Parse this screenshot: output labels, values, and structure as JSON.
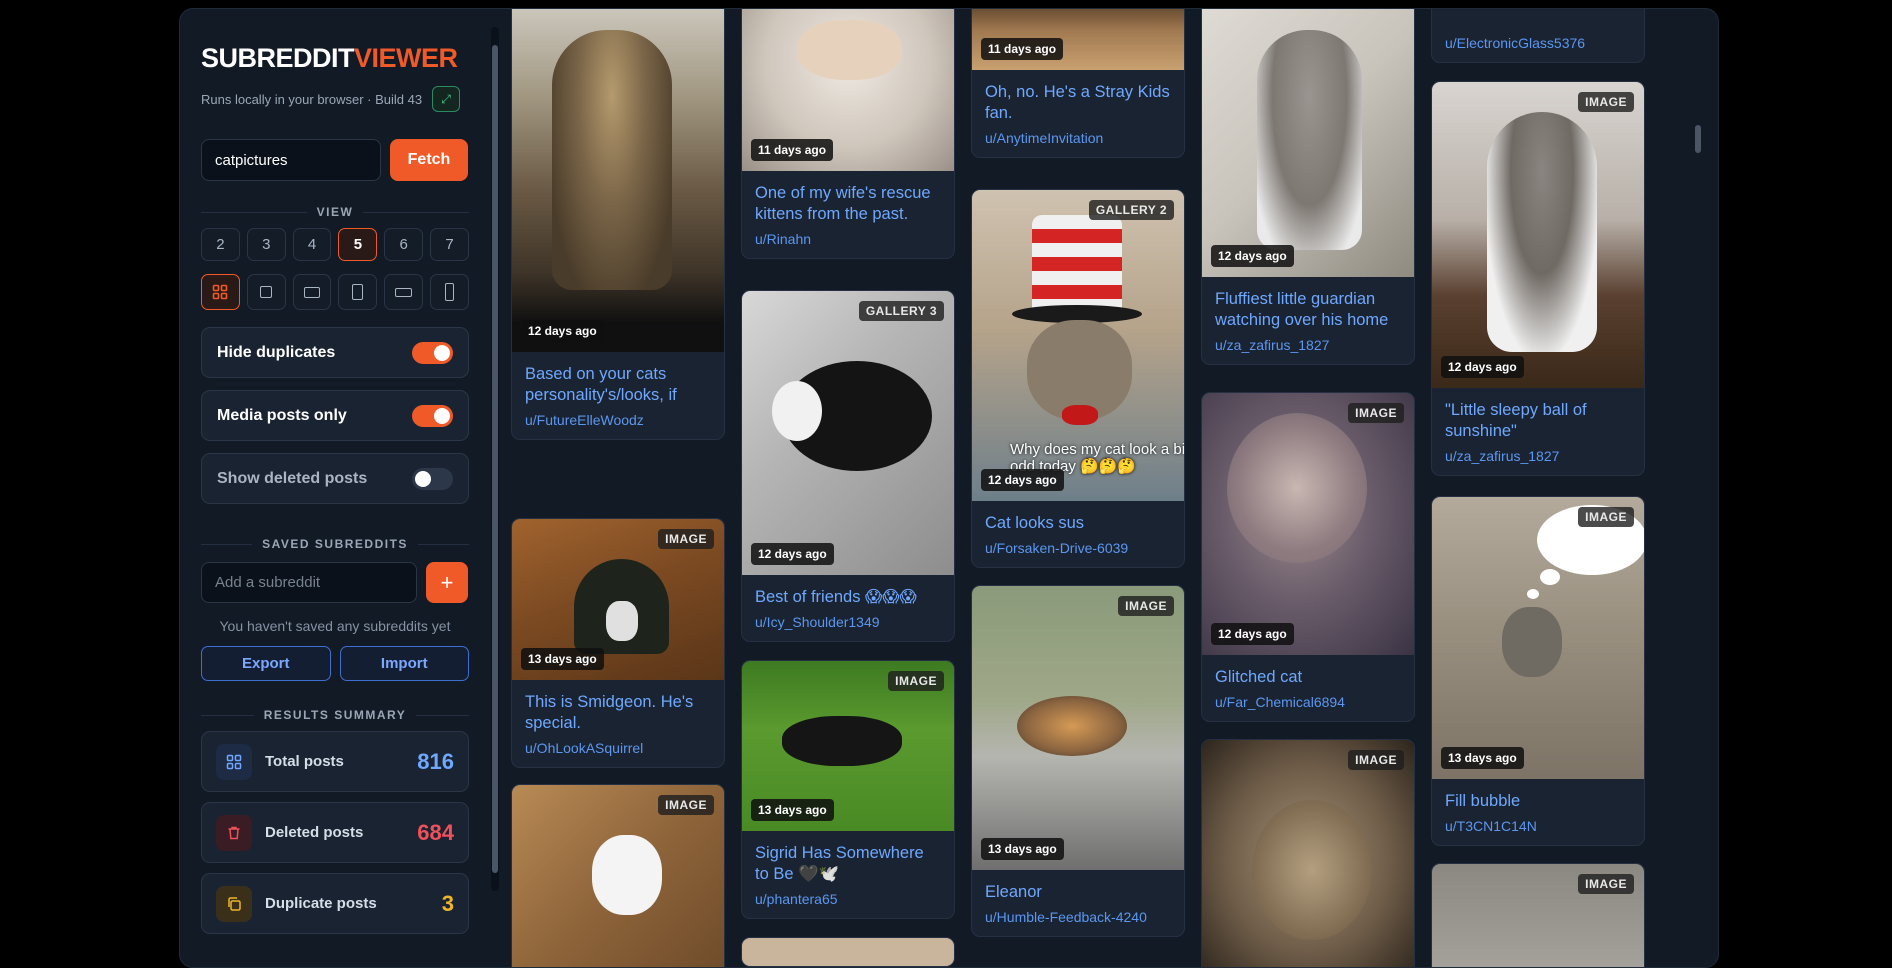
{
  "brand": {
    "part1": "SUBREDDIT",
    "part2": "VIEWER",
    "subtitle": "Runs locally in your browser · Build 43"
  },
  "search": {
    "value": "catpictures",
    "fetch_label": "Fetch"
  },
  "view": {
    "label": "VIEW",
    "columns": [
      "2",
      "3",
      "4",
      "5",
      "6",
      "7"
    ],
    "active_columns": "5"
  },
  "toggles": {
    "hide_duplicates": "Hide duplicates",
    "media_only": "Media posts only",
    "show_deleted": "Show deleted posts"
  },
  "saved": {
    "label": "SAVED SUBREDDITS",
    "placeholder": "Add a subreddit",
    "add_label": "+",
    "empty": "You haven't saved any subreddits yet",
    "export": "Export",
    "import": "Import"
  },
  "summary": {
    "label": "RESULTS SUMMARY",
    "total_label": "Total posts",
    "total": "816",
    "deleted_label": "Deleted posts",
    "deleted": "684",
    "duplicate_label": "Duplicate posts",
    "duplicate": "3"
  },
  "colors": {
    "accent": "#f05a28",
    "link": "#6ea8ff",
    "total": "#6ea8ff",
    "deleted": "#f0505a",
    "duplicate": "#f0b429"
  },
  "posts": [
    {
      "badge": "",
      "age": "12 days ago",
      "title": "Based on your cats personality's/looks, if",
      "author": "u/FutureElleWoodz"
    },
    {
      "badge": "IMAGE",
      "age": "13 days ago",
      "title": "This is Smidgeon. He's special.",
      "author": "u/OhLookASquirrel"
    },
    {
      "badge": "IMAGE",
      "age": "",
      "title": "",
      "author": ""
    },
    {
      "badge": "",
      "age": "11 days ago",
      "title": "One of my wife's rescue kittens from the past.",
      "author": "u/Rinahn"
    },
    {
      "badge": "GALLERY 3",
      "age": "12 days ago",
      "title": "Best of friends 😱😱😱",
      "author": "u/Icy_Shoulder1349"
    },
    {
      "badge": "IMAGE",
      "age": "13 days ago",
      "title": "Sigrid Has Somewhere to Be 🖤🕊️",
      "author": "u/phantera65"
    },
    {
      "badge": "",
      "age": "11 days ago",
      "title": "Oh, no. He's a Stray Kids fan.",
      "author": "u/AnytimeInvitation"
    },
    {
      "badge": "GALLERY 2",
      "age": "12 days ago",
      "title": "Cat looks sus",
      "author": "u/Forsaken-Drive-6039",
      "caption": "Why does my cat look a bit odd today 🤔🤔🤔"
    },
    {
      "badge": "IMAGE",
      "age": "13 days ago",
      "title": "Eleanor",
      "author": "u/Humble-Feedback-4240"
    },
    {
      "badge": "",
      "age": "12 days ago",
      "title": "Fluffiest little guardian watching over his home",
      "author": "u/za_zafirus_1827"
    },
    {
      "badge": "IMAGE",
      "age": "12 days ago",
      "title": "Glitched cat",
      "author": "u/Far_Chemical6894"
    },
    {
      "badge": "IMAGE",
      "age": "",
      "title": "",
      "author": ""
    },
    {
      "badge": "",
      "age": "",
      "title": "",
      "author": "u/ElectronicGlass5376"
    },
    {
      "badge": "IMAGE",
      "age": "12 days ago",
      "title": "\"Little sleepy ball of sunshine\"",
      "author": "u/za_zafirus_1827"
    },
    {
      "badge": "IMAGE",
      "age": "13 days ago",
      "title": "Fill bubble",
      "author": "u/T3CN1C14N"
    },
    {
      "badge": "IMAGE",
      "age": "",
      "title": "",
      "author": ""
    }
  ]
}
